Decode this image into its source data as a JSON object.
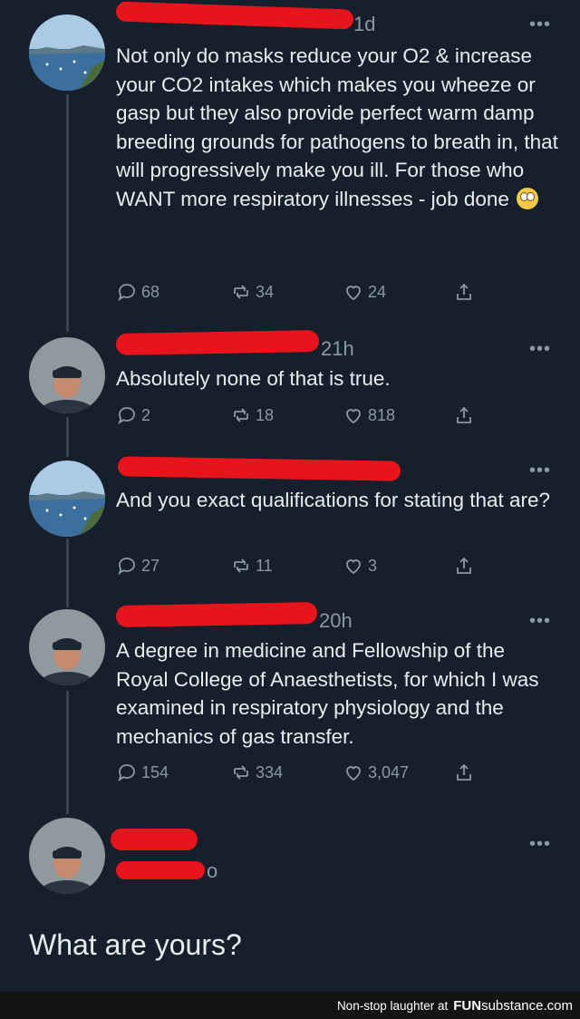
{
  "tweets": [
    {
      "time": "1d",
      "text": "Not only do masks reduce your O2 & increase your CO2 intakes which makes you wheeze or gasp but they also provide perfect warm damp breeding grounds for pathogens to breath in, that will progressively make you ill. For those who WANT more respiratory illnesses - job done",
      "replies": "68",
      "retweets": "34",
      "likes": "24",
      "avatar": "coastal-landscape"
    },
    {
      "time": "21h",
      "text": "Absolutely none of that is true.",
      "replies": "2",
      "retweets": "18",
      "likes": "818",
      "avatar": "man-in-beanie"
    },
    {
      "time": "",
      "text": "And you exact qualifications for stating that are?",
      "replies": "27",
      "retweets": "11",
      "likes": "3",
      "avatar": "coastal-landscape"
    },
    {
      "time": "20h",
      "text": "A degree in medicine and Fellowship of the Royal College of Anaesthetists, for which I was examined in respiratory physiology and the mechanics of gas transfer.",
      "replies": "154",
      "retweets": "334",
      "likes": "3,047",
      "avatar": "man-in-beanie"
    }
  ],
  "final_tweet": {
    "handle_fragment": "o",
    "avatar": "man-in-beanie"
  },
  "more_label": "•••",
  "question": "What are yours?",
  "footer": {
    "tagline": "Non-stop laughter at",
    "brand_bold": "FUN",
    "brand_rest": "substance",
    "brand_tld": ".com"
  },
  "colors": {
    "background": "#16202c",
    "redaction": "#e8141c",
    "muted": "#8b98a5",
    "text": "#e9edf1"
  }
}
